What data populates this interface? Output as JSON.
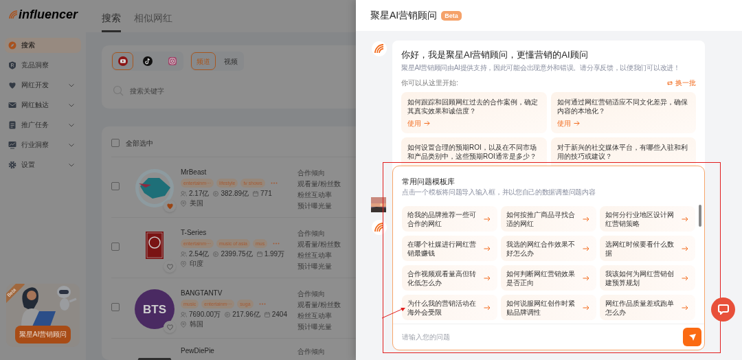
{
  "logo": {
    "text": "influencer"
  },
  "nav": [
    {
      "label": "搜索",
      "selected": true,
      "expandable": false
    },
    {
      "label": "竞品洞察",
      "selected": false,
      "expandable": false
    },
    {
      "label": "网红开发",
      "selected": false,
      "expandable": true
    },
    {
      "label": "网红触达",
      "selected": false,
      "expandable": true
    },
    {
      "label": "推广任务",
      "selected": false,
      "expandable": true
    },
    {
      "label": "行业洞察",
      "selected": false,
      "expandable": true
    },
    {
      "label": "设置",
      "selected": false,
      "expandable": true
    }
  ],
  "promo": {
    "badge": "Beta",
    "button": "聚星AI营销顾问"
  },
  "tabs": [
    {
      "label": "搜索",
      "selected": true
    },
    {
      "label": "相似网红",
      "selected": false
    }
  ],
  "platforms": [
    {
      "kind": "youtube",
      "selected": true
    },
    {
      "kind": "tiktok",
      "selected": false
    },
    {
      "kind": "instagram",
      "selected": false
    }
  ],
  "content_types": [
    {
      "label": "频道",
      "selected": true
    },
    {
      "label": "视频",
      "selected": false
    }
  ],
  "search": {
    "placeholder": "搜索关键字"
  },
  "select_all": {
    "label": "全部选中",
    "checked": false
  },
  "influencers": [
    {
      "name": "MrBeast",
      "checked": false,
      "tags": [
        "entertainm···",
        "lifestyle",
        "tv shows"
      ],
      "followers": "2.17亿",
      "views": "382.89亿",
      "videos": "771",
      "location": "美国",
      "favorite": true,
      "metrics": [
        "合作倾向",
        "观看量/粉丝数",
        "粉丝互动率",
        "预计曝光量"
      ]
    },
    {
      "name": "T-Series",
      "checked": false,
      "tags": [
        "entertainm···",
        "music of asia",
        "mus"
      ],
      "followers": "2.54亿",
      "views": "2399.75亿",
      "videos": "1.99万",
      "location": "印度",
      "favorite": false,
      "metrics": [
        "合作倾向",
        "观看量/粉丝数",
        "粉丝互动率",
        "预计曝光量"
      ]
    },
    {
      "name": "BANGTANTV",
      "checked": false,
      "avatar_text": "BTS",
      "tags": [
        "music",
        "entertainm···",
        "suga"
      ],
      "followers": "7690.00万",
      "views": "217.96亿",
      "videos": "2404",
      "location": "韩国",
      "favorite": false,
      "metrics": [
        "合作倾向",
        "观看量/粉丝数",
        "粉丝互动率",
        "预计曝光量"
      ]
    },
    {
      "name": "PewDiePie",
      "metrics": [
        "合作倾向"
      ]
    }
  ],
  "assistant": {
    "title": "聚星AI营销顾问",
    "badge": "Beta",
    "greeting": {
      "title": "你好，我是聚星AI营销顾问，更懂营销的AI顾问",
      "disclaimer": "聚星AI营销顾问由AI提供支持，因此可能会出现意外和错误。请分享反馈，以便我们可以改进！",
      "start_label": "你可以从这里开始:",
      "refresh": "换一批",
      "suggestions": [
        {
          "text": "如何跟踪和回顾网红过去的合作案例，确定其真实效果和诚信度？",
          "action": "使用"
        },
        {
          "text": "如何通过网红营销适应不同文化差异，确保内容的本地化？",
          "action": "使用"
        },
        {
          "text": "如何设置合理的预期ROI，以及在不同市场和产品类别中，这些预期ROI通常是多少？"
        },
        {
          "text": "对于新兴的社交媒体平台，有哪些入驻和利用的技巧或建议？"
        }
      ]
    },
    "templates": {
      "title": "常用问题模板库",
      "subtitle": "点击一个模板将问题导入输入框，并以您自己的数据调整问题内容",
      "items": [
        "给我的品牌推荐一些可合作的网红",
        "如何按推广商品寻找合适的网红",
        "如何分行业地区设计网红营销策略",
        "在哪个社媒进行网红营销最赚钱",
        "我选的网红合作效果不好怎么办",
        "选网红时候要看什么数据",
        "合作视频观看量高但转化低怎么办",
        "如何判断网红营销效果是否正向",
        "我该如何为网红营销创建预算规划",
        "为什么我的营销活动在海外会受限",
        "如何说服网红创作时紧贴品牌调性",
        "网红作品质量差或跑单怎么办"
      ]
    },
    "input": {
      "placeholder": "请输入您的问题"
    }
  }
}
